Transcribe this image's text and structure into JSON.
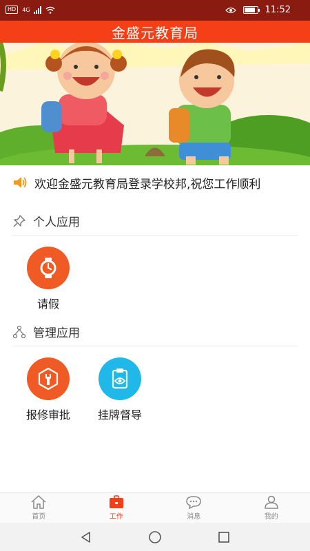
{
  "status_bar": {
    "network_badge": "HD",
    "network_type": "4G",
    "time": "11:52",
    "battery_level": 0.85
  },
  "header": {
    "title": "金盛元教育局"
  },
  "banner": {
    "icon": "children-illustration"
  },
  "notice": {
    "icon": "speaker-icon",
    "text": "欢迎金盛元教育局登录学校邦,祝您工作顺利"
  },
  "personal_apps": {
    "title": "个人应用",
    "icon": "pushpin-icon",
    "items": [
      {
        "label": "请假",
        "icon": "watch-icon",
        "color": "#f05a24"
      }
    ]
  },
  "management_apps": {
    "title": "管理应用",
    "icon": "hierarchy-icon",
    "items": [
      {
        "label": "报修审批",
        "icon": "wrench-icon",
        "color": "#f05a24"
      },
      {
        "label": "挂牌督导",
        "icon": "clipboard-eye-icon",
        "color": "#1fb8e8"
      }
    ]
  },
  "tabs": [
    {
      "label": "首页",
      "icon": "home-icon",
      "active": false
    },
    {
      "label": "工作",
      "icon": "briefcase-icon",
      "active": true
    },
    {
      "label": "消息",
      "icon": "chat-bubble-icon",
      "active": false
    },
    {
      "label": "我的",
      "icon": "user-icon",
      "active": false
    }
  ],
  "colors": {
    "status_bar": "#8a1b10",
    "header": "#f53f16",
    "accent": "#f53f16",
    "orange_icon": "#f05a24",
    "blue_icon": "#1fb8e8"
  }
}
